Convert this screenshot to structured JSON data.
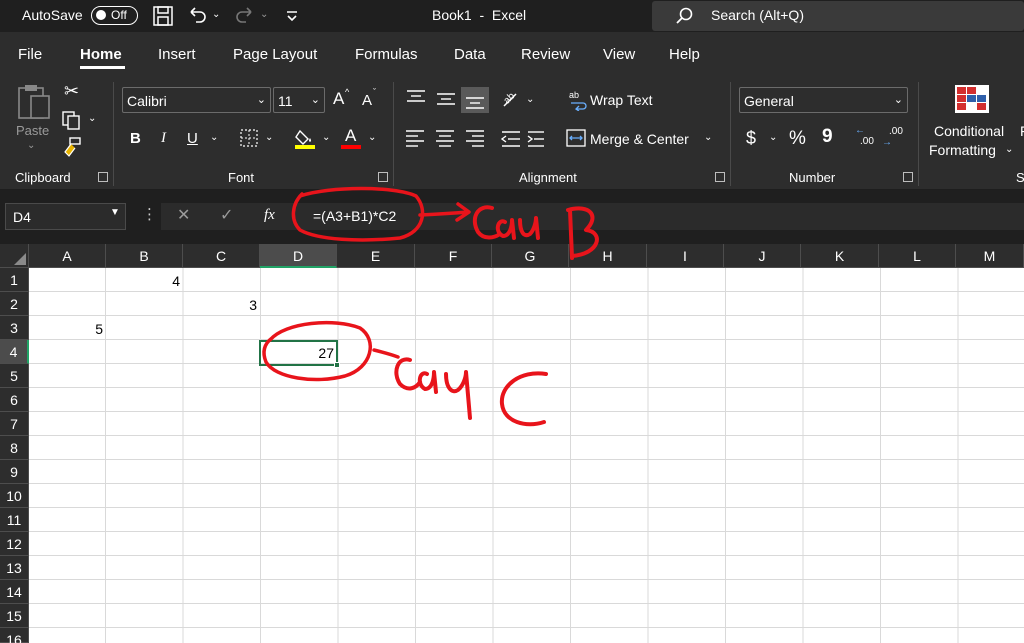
{
  "titlebar": {
    "autosave_label": "AutoSave",
    "autosave_state": "Off",
    "title": "Book1  -  Excel",
    "search_placeholder": "Search (Alt+Q)"
  },
  "tabs": [
    "File",
    "Home",
    "Insert",
    "Page Layout",
    "Formulas",
    "Data",
    "Review",
    "View",
    "Help"
  ],
  "active_tab": "Home",
  "ribbon": {
    "clipboard": {
      "paste_label": "Paste",
      "group_label": "Clipboard"
    },
    "font": {
      "font_name": "Calibri",
      "font_size": "11",
      "bold": "B",
      "italic": "I",
      "underline": "U",
      "grow": "A",
      "shrink": "A",
      "font_color": "A",
      "group_label": "Font"
    },
    "alignment": {
      "wrap_text": "Wrap Text",
      "merge_center": "Merge & Center",
      "group_label": "Alignment"
    },
    "number": {
      "format": "General",
      "currency": "$",
      "percent": "%",
      "comma": "9",
      "increase_decimal": ".00",
      "decrease_decimal": ".00",
      "group_label": "Number"
    },
    "styles": {
      "conditional_line1": "Conditional",
      "conditional_line2": "Formatting",
      "group_label_partial": "S"
    }
  },
  "formula_bar": {
    "name_box": "D4",
    "formula": "=(A3+B1)*C2"
  },
  "columns": [
    "A",
    "B",
    "C",
    "D",
    "E",
    "F",
    "G",
    "H",
    "I",
    "J",
    "K",
    "L",
    "M"
  ],
  "rows": [
    "1",
    "2",
    "3",
    "4",
    "5",
    "6",
    "7",
    "8",
    "9",
    "10",
    "11",
    "12",
    "13",
    "14",
    "15",
    "16"
  ],
  "selected_cell": {
    "col": "D",
    "row": "4"
  },
  "cells": {
    "B1": "4",
    "C2": "3",
    "A3": "5",
    "D4": "27"
  },
  "annotations": {
    "label_b": "Câu B",
    "label_c": "Câu C",
    "ink_color": "#e8141b"
  },
  "colors": {
    "accent_green": "#217346",
    "ribbon_bg": "#2d2d2d",
    "titlebar_bg": "#1f1f1f"
  }
}
